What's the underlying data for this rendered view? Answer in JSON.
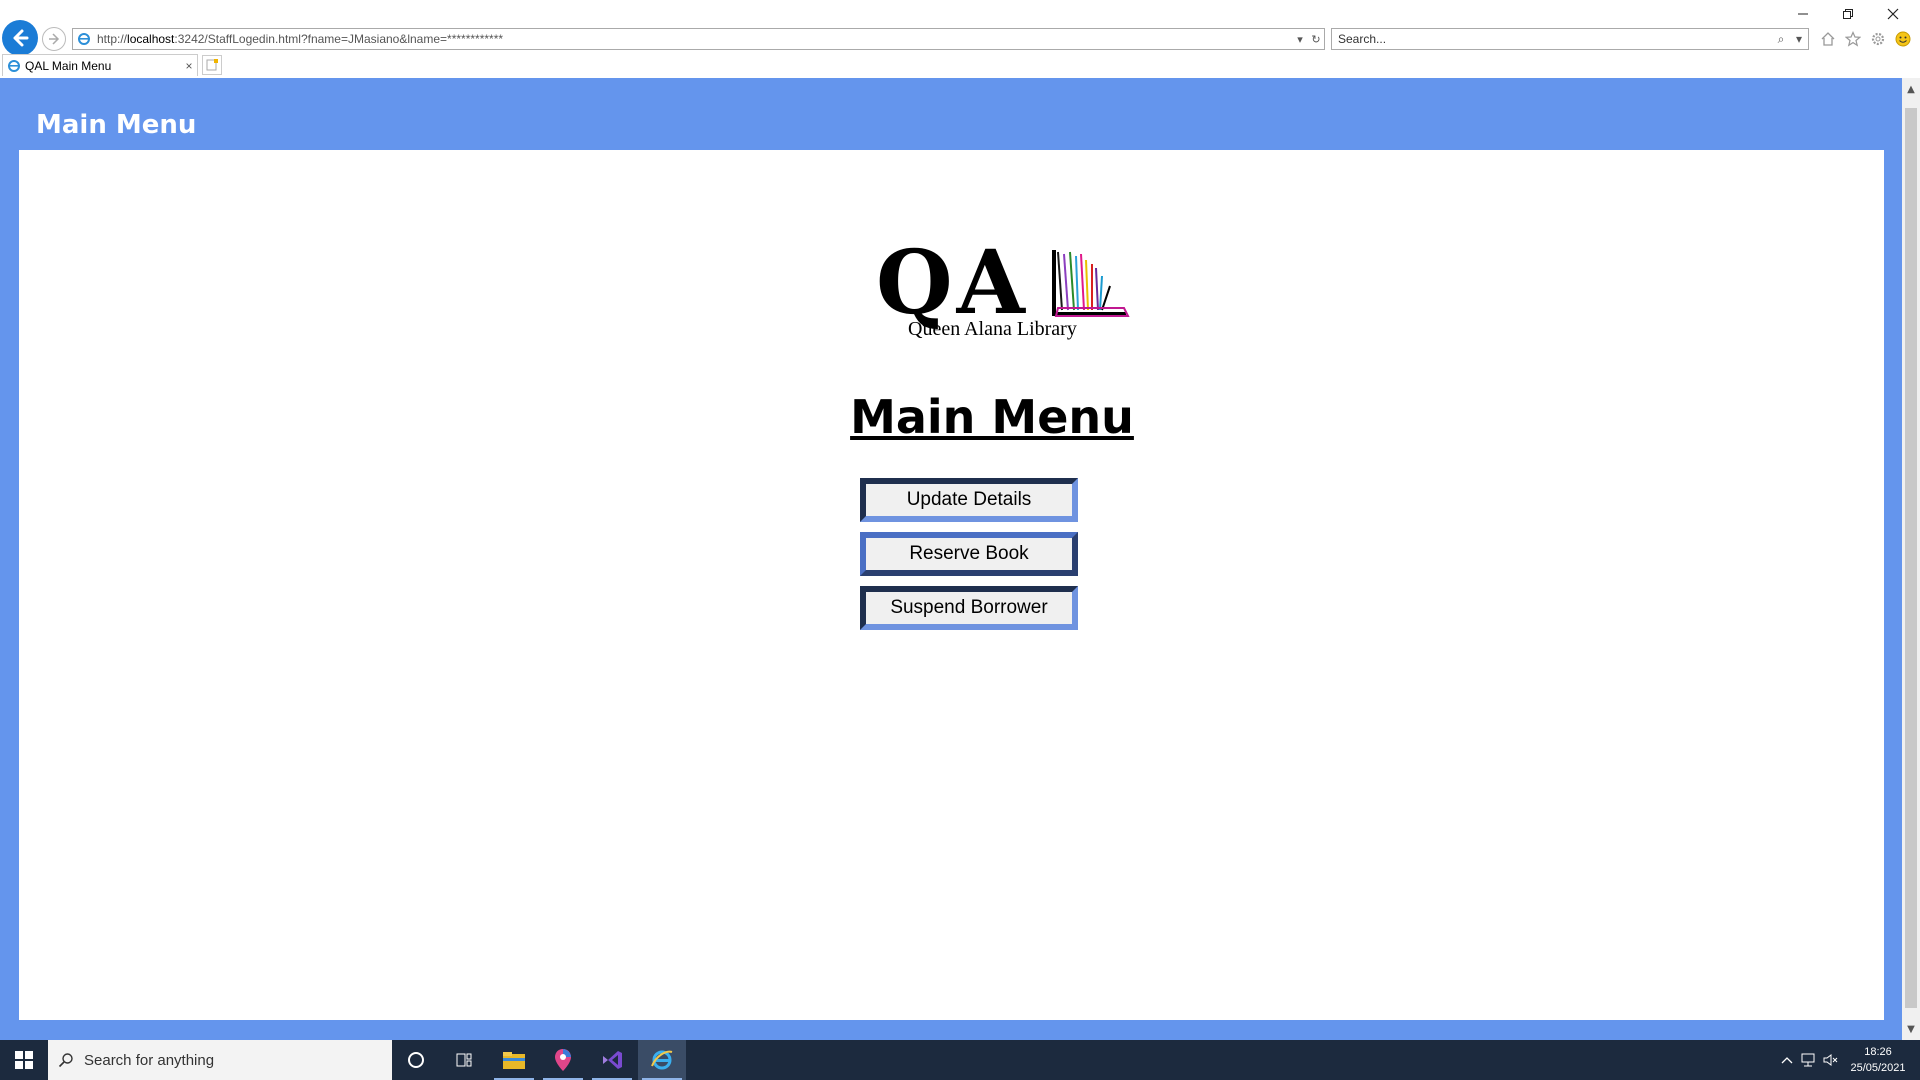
{
  "browser": {
    "url_prefix": "http://",
    "url_host": "localhost",
    "url_rest": ":3242/StaffLogedin.html?fname=JMasiano&lname=************",
    "search_placeholder": "Search...",
    "tab_title": "QAL Main Menu",
    "tab_close": "×"
  },
  "page": {
    "header_title": "Main Menu",
    "logo": {
      "letters": "QA",
      "subtitle": "Queen Alana Library"
    },
    "heading": "Main Menu",
    "buttons": {
      "update": "Update Details",
      "reserve": "Reserve Book",
      "suspend": "Suspend Borrower"
    }
  },
  "taskbar": {
    "search_placeholder": "Search for anything",
    "time": "18:26",
    "date": "25/05/2021"
  },
  "colors": {
    "page_background": "#6495ed",
    "accent": "#1b7cd6",
    "taskbar": "#1c2a3e"
  }
}
